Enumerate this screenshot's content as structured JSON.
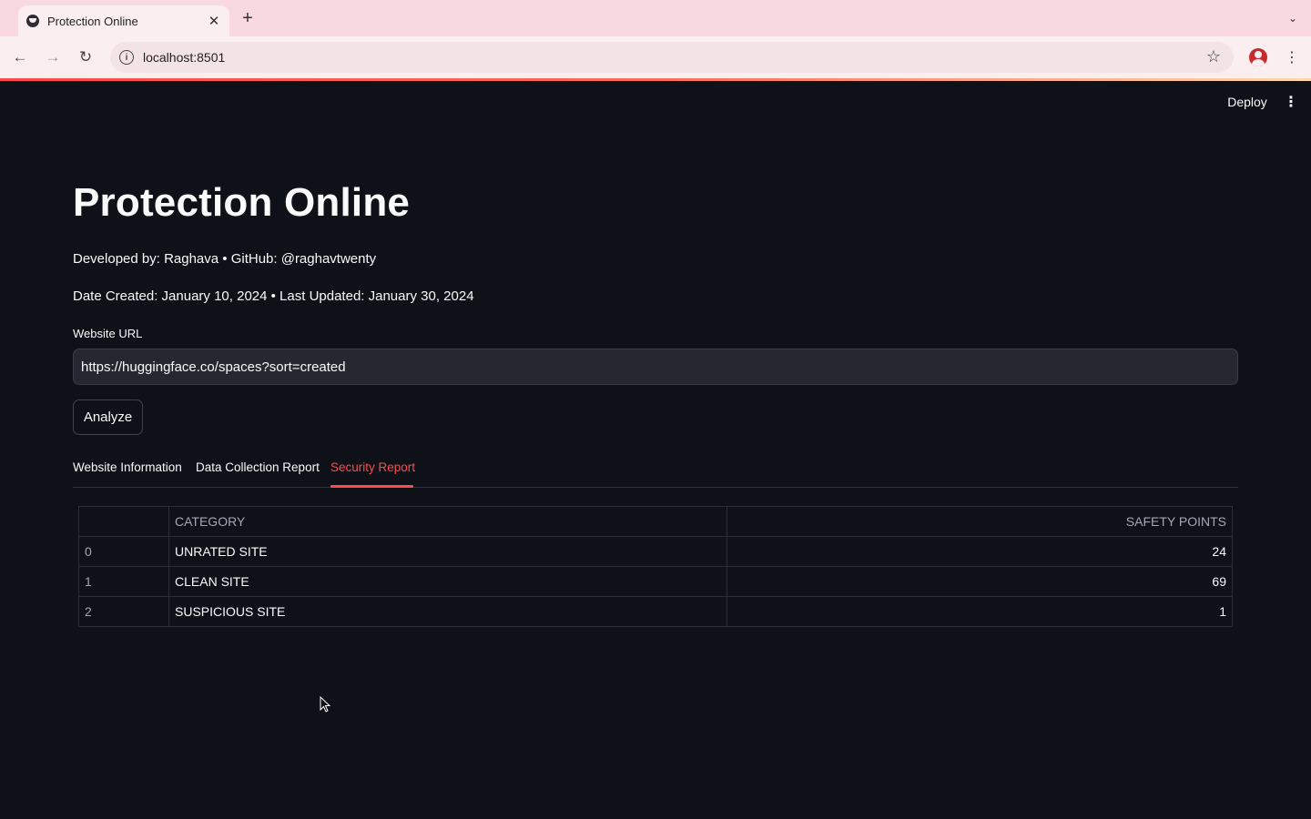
{
  "browser": {
    "tab_title": "Protection Online",
    "url": "localhost:8501"
  },
  "app": {
    "deploy_label": "Deploy",
    "title": "Protection Online",
    "developer_line": "Developed by: Raghava • GitHub: @raghavtwenty",
    "date_line": "Date Created: January 10, 2024 • Last Updated: January 30, 2024",
    "url_label": "Website URL",
    "url_value": "https://huggingface.co/spaces?sort=created",
    "analyze_label": "Analyze",
    "accent_color": "#ff4b4b"
  },
  "tabs": [
    {
      "label": "Website Information",
      "active": false
    },
    {
      "label": "Data Collection Report",
      "active": false
    },
    {
      "label": "Security Report",
      "active": true
    }
  ],
  "table": {
    "headers": [
      "",
      "CATEGORY",
      "SAFETY POINTS"
    ],
    "rows": [
      {
        "index": "0",
        "category": "UNRATED SITE",
        "points": "24"
      },
      {
        "index": "1",
        "category": "CLEAN SITE",
        "points": "69"
      },
      {
        "index": "2",
        "category": "SUSPICIOUS SITE",
        "points": "1"
      }
    ]
  }
}
